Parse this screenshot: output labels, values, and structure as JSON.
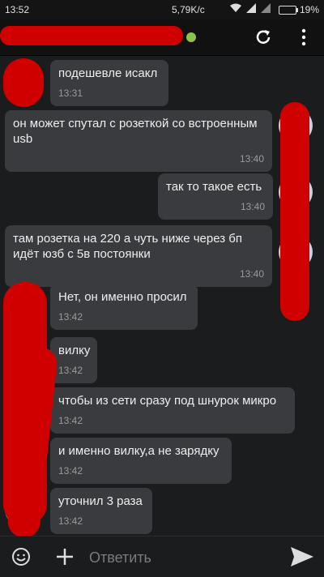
{
  "status_bar": {
    "time": "13:52",
    "network_speed": "5,79K/c",
    "battery": "19%",
    "battery_level": 0.19
  },
  "header": {
    "title": "",
    "online": true
  },
  "messages": [
    {
      "direction": "in",
      "text": "подешевле исакл",
      "time": "13:31"
    },
    {
      "direction": "in",
      "text": "он может спутал с розеткой со встроенным usb",
      "time": "13:40"
    },
    {
      "direction": "out",
      "text": "так то такое есть",
      "time": "13:40"
    },
    {
      "direction": "in",
      "text": "там розетка на 220 а чуть ниже через бп идёт юзб с 5в постоянки",
      "time": "13:40"
    },
    {
      "direction": "in",
      "text": "Нет, он именно просил",
      "time": "13:42"
    },
    {
      "direction": "in",
      "text": "вилку",
      "time": "13:42"
    },
    {
      "direction": "in",
      "text": "чтобы из сети сразу под шнурок микро",
      "time": "13:42"
    },
    {
      "direction": "in",
      "text": "и именно вилку,а не зарядку",
      "time": "13:42"
    },
    {
      "direction": "in",
      "text": "уточнил 3 раза",
      "time": "13:42"
    }
  ],
  "composer": {
    "placeholder": "Ответить"
  },
  "colors": {
    "background": "#1b1c1e",
    "bubble": "#3a3b3f",
    "online": "#8bc34a",
    "redaction": "#d10000"
  }
}
